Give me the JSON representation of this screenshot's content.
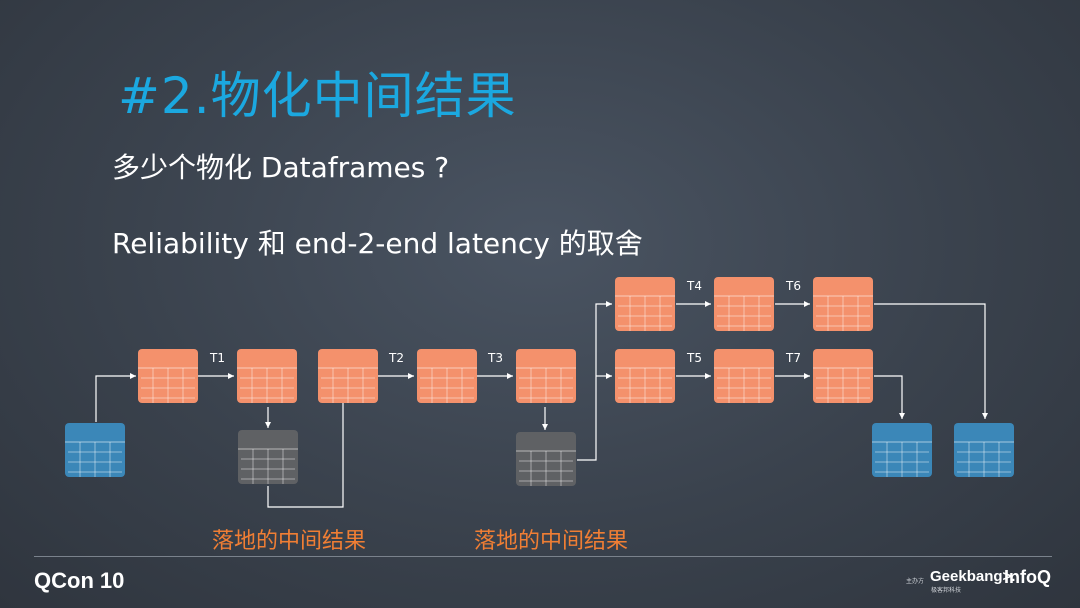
{
  "slide": {
    "title": "#2.物化中间结果",
    "bullets": [
      "多少个物化 Dataframes ?",
      "Reliability 和 end-2-end latency 的取舍"
    ],
    "captions": [
      "落地的中间结果",
      "落地的中间结果"
    ]
  },
  "diagram": {
    "edge_labels": [
      "T1",
      "T2",
      "T3",
      "T4",
      "T5",
      "T6",
      "T7"
    ],
    "colors": {
      "transform_table": "#f4916c",
      "source_sink_table": "#3b87b8",
      "persisted_table": "#5f6164",
      "edge": "#ffffff",
      "caption": "#f07e34"
    }
  },
  "footer": {
    "brand": "QCon",
    "brand_badge": "10",
    "organizer_label": "主办方",
    "geekbang": "Geekbang>.",
    "geekbang_sub": "极客邦科技",
    "infoq": "InfoQ"
  },
  "colors": {
    "title": "#1ba8e0",
    "text": "#ffffff"
  }
}
